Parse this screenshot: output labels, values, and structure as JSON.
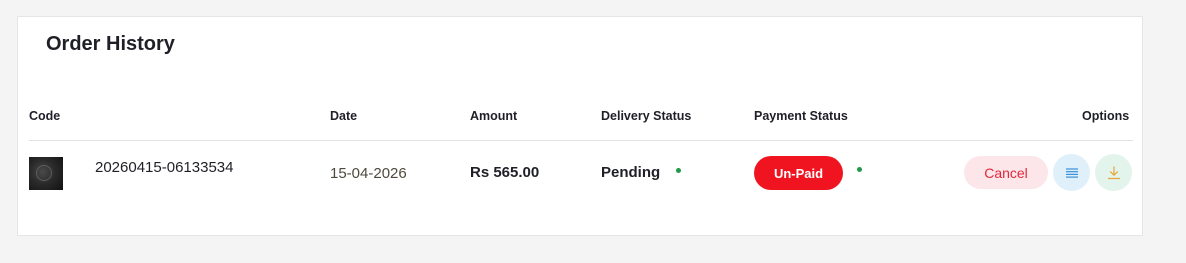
{
  "page": {
    "title": "Order History"
  },
  "table": {
    "headers": {
      "code": "Code",
      "date": "Date",
      "amount": "Amount",
      "delivery_status": "Delivery Status",
      "payment_status": "Payment Status",
      "options": "Options"
    },
    "rows": [
      {
        "code": "20260415-06133534",
        "date": "15-04-2026",
        "amount": "Rs 565.00",
        "delivery_status": "Pending",
        "payment_status": "Un-Paid",
        "actions": {
          "cancel_label": "Cancel",
          "details_icon": "list-icon",
          "download_icon": "download-icon"
        }
      }
    ]
  },
  "colors": {
    "unpaid_badge": "#ef1420",
    "cancel_bg": "#fce6ea",
    "cancel_text": "#e0293b",
    "details_bg": "#dff0fb",
    "details_icon": "#3a8fd6",
    "download_bg": "#e2f4ec",
    "download_icon": "#e8a33a",
    "status_dot": "#1f9a4a"
  }
}
